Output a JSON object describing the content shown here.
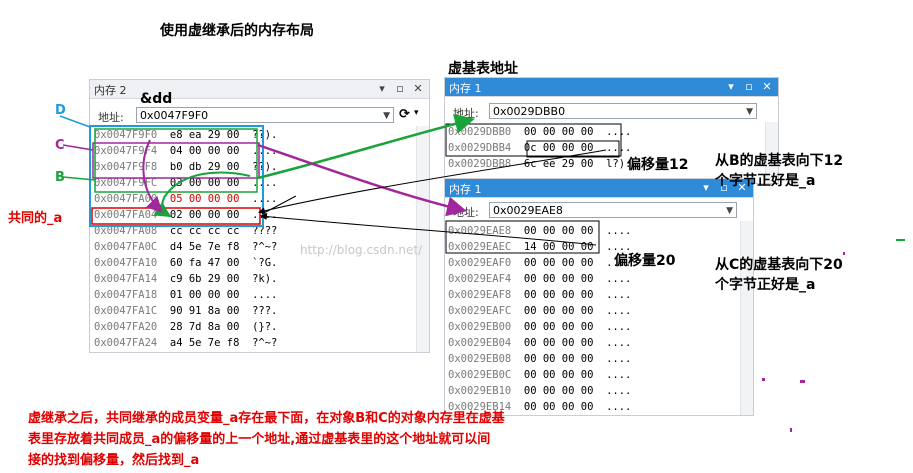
{
  "title": "使用虚继承后的内存布局",
  "labels": {
    "dd": "&dd",
    "vbtable_addr": "虚基表地址",
    "D": "D",
    "C": "C",
    "B": "B",
    "common_a": "共同的_a",
    "offset12": "偏移量12",
    "offset20": "偏移量20",
    "note_b_line1": "从B的虚基表向下12",
    "note_b_line2": "个字节正好是_a",
    "note_c_line1": "从C的虚基表向下20",
    "note_c_line2": "个字节正好是_a",
    "footnote_line1": "虚继承之后，共同继承的成员变量_a存在最下面，在对象B和C的对象内存里在虚基",
    "footnote_line2": "表里存放着共同成员_a的偏移量的上一个地址,通过虚基表里的这个地址就可以间",
    "footnote_line3": "接的找到偏移量，然后找到_a",
    "watermark": "http://blog.csdn.net/"
  },
  "memory2": {
    "title": "内存 2",
    "address_label": "地址:",
    "address": "0x0047F9F0",
    "rows": [
      {
        "addr": "0x0047F9F0",
        "bytes": "e8 ea 29 00",
        "ascii": "??)."
      },
      {
        "addr": "0x0047F9F4",
        "bytes": "04 00 00 00",
        "ascii": "...."
      },
      {
        "addr": "0x0047F9F8",
        "bytes": "b0 db 29 00",
        "ascii": "??)."
      },
      {
        "addr": "0x0047F9FC",
        "bytes": "03 00 00 00",
        "ascii": "...."
      },
      {
        "addr": "0x0047FA00",
        "bytes": "05 00 00 00",
        "ascii": "...."
      },
      {
        "addr": "0x0047FA04",
        "bytes": "02 00 00 00",
        "ascii": "...."
      },
      {
        "addr": "0x0047FA08",
        "bytes": "cc cc cc cc",
        "ascii": "????"
      },
      {
        "addr": "0x0047FA0C",
        "bytes": "d4 5e 7e f8",
        "ascii": "?^~?"
      },
      {
        "addr": "0x0047FA10",
        "bytes": "60 fa 47 00",
        "ascii": "`?G."
      },
      {
        "addr": "0x0047FA14",
        "bytes": "c9 6b 29 00",
        "ascii": "?k)."
      },
      {
        "addr": "0x0047FA18",
        "bytes": "01 00 00 00",
        "ascii": "...."
      },
      {
        "addr": "0x0047FA1C",
        "bytes": "90 91 8a 00",
        "ascii": "???."
      },
      {
        "addr": "0x0047FA20",
        "bytes": "28 7d 8a 00",
        "ascii": "(}?."
      },
      {
        "addr": "0x0047FA24",
        "bytes": "a4 5e 7e f8",
        "ascii": "?^~?"
      }
    ]
  },
  "memory1_top": {
    "title": "内存 1",
    "address_label": "地址:",
    "address": "0x0029DBB0",
    "rows": [
      {
        "addr": "0x0029DBB0",
        "bytes": "00 00 00 00",
        "ascii": "...."
      },
      {
        "addr": "0x0029DBB4",
        "bytes": "0c 00 00 00",
        "ascii": "...."
      },
      {
        "addr": "0x0029DBB8",
        "bytes": "6c ee 29 00",
        "ascii": "l?)."
      }
    ]
  },
  "memory1_bottom": {
    "title": "内存 1",
    "address_label": "地址:",
    "address": "0x0029EAE8",
    "rows": [
      {
        "addr": "0x0029EAE8",
        "bytes": "00 00 00 00",
        "ascii": "...."
      },
      {
        "addr": "0x0029EAEC",
        "bytes": "14 00 00 00",
        "ascii": "...."
      },
      {
        "addr": "0x0029EAF0",
        "bytes": "00 00 00 00",
        "ascii": "...."
      },
      {
        "addr": "0x0029EAF4",
        "bytes": "00 00 00 00",
        "ascii": "...."
      },
      {
        "addr": "0x0029EAF8",
        "bytes": "00 00 00 00",
        "ascii": "...."
      },
      {
        "addr": "0x0029EAFC",
        "bytes": "00 00 00 00",
        "ascii": "...."
      },
      {
        "addr": "0x0029EB00",
        "bytes": "00 00 00 00",
        "ascii": "...."
      },
      {
        "addr": "0x0029EB04",
        "bytes": "00 00 00 00",
        "ascii": "...."
      },
      {
        "addr": "0x0029EB08",
        "bytes": "00 00 00 00",
        "ascii": "...."
      },
      {
        "addr": "0x0029EB0C",
        "bytes": "00 00 00 00",
        "ascii": "...."
      },
      {
        "addr": "0x0029EB10",
        "bytes": "00 00 00 00",
        "ascii": "...."
      },
      {
        "addr": "0x0029EB14",
        "bytes": "00 00 00 00",
        "ascii": "...."
      }
    ]
  },
  "colors": {
    "D": "#1f9bd7",
    "C": "#a0289c",
    "B": "#1aa33a",
    "red": "#e00000",
    "accent": "#2f8ad8"
  },
  "icons": [
    "pin-icon",
    "maximize-icon",
    "close-icon",
    "refresh-icon",
    "chevron-down-icon"
  ]
}
